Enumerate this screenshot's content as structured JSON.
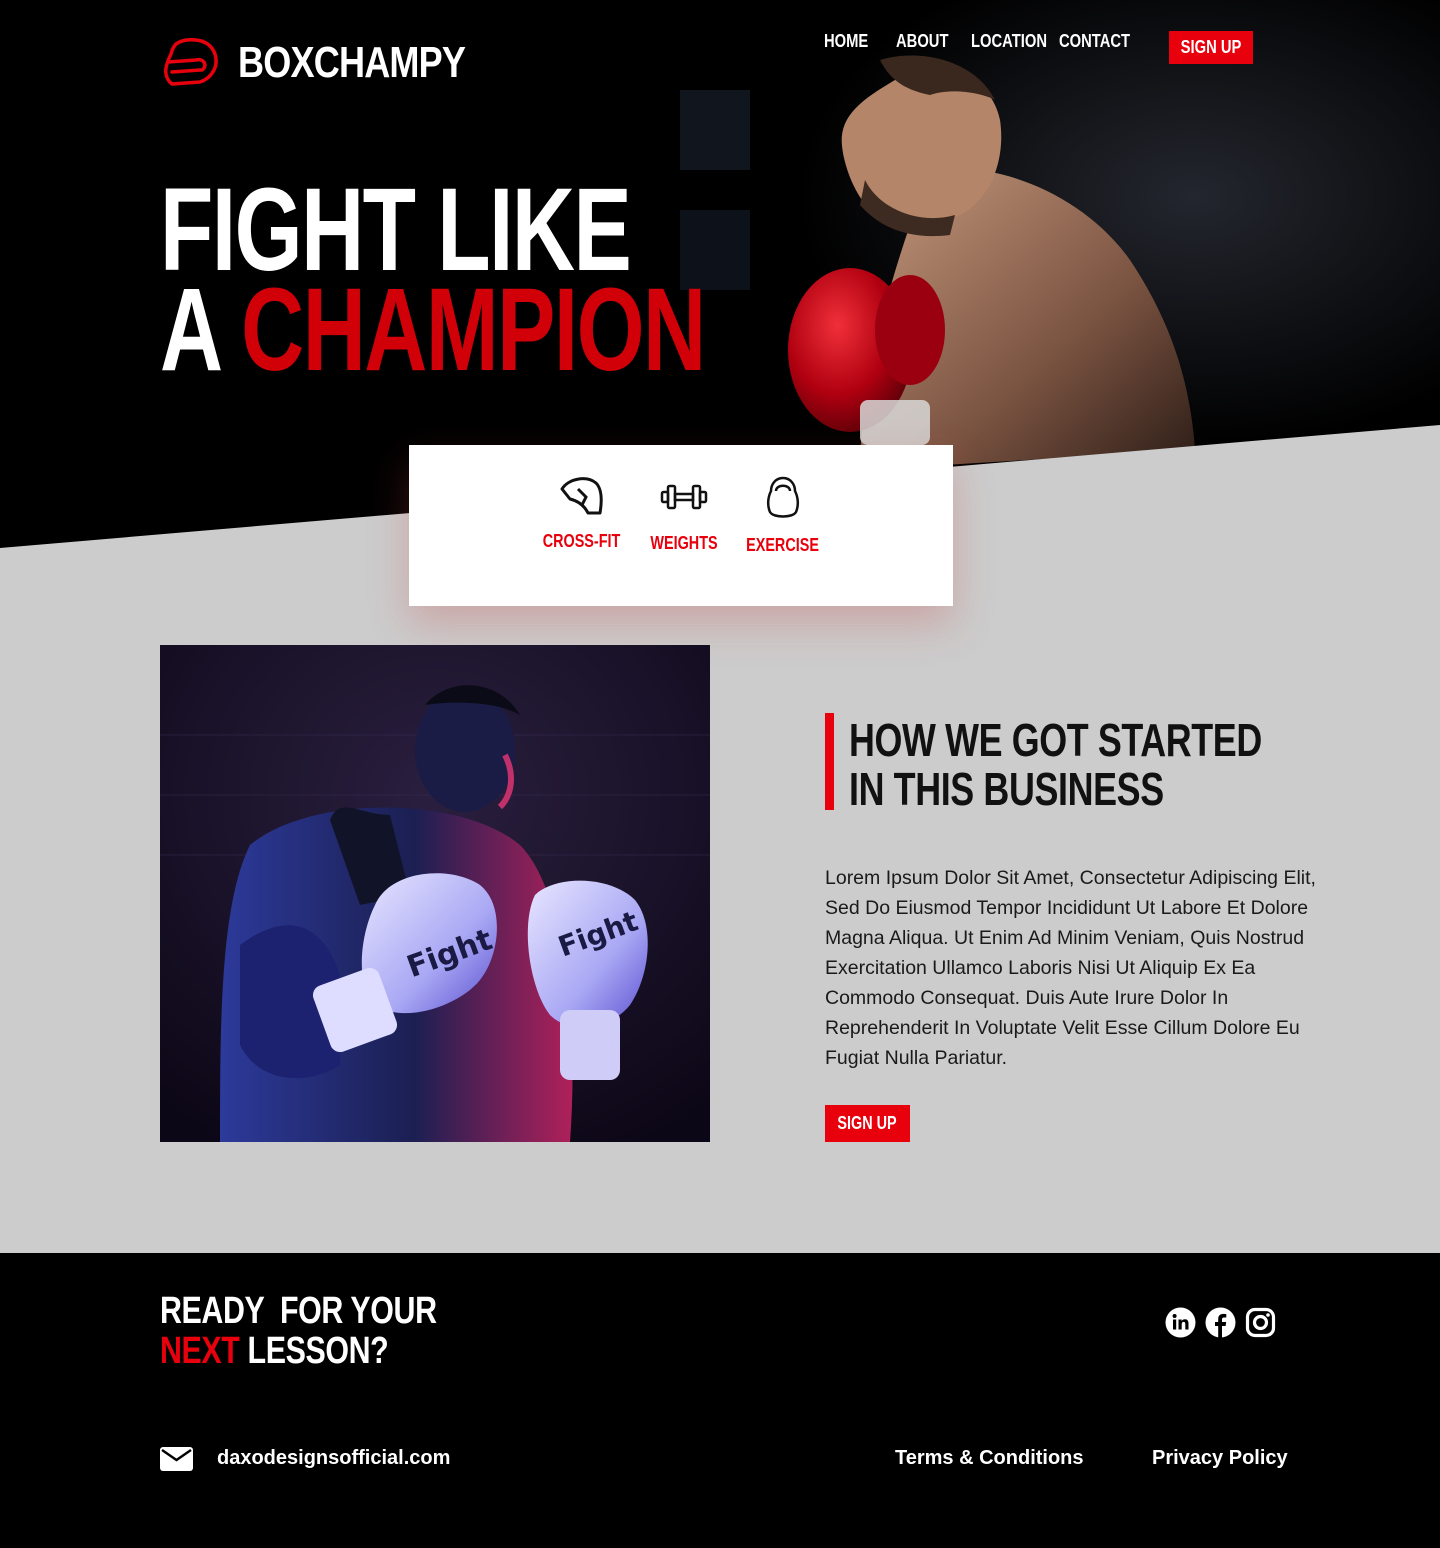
{
  "brand": {
    "name": "BOXCHAMPY",
    "accent": "#e8000c",
    "dark": "#000000",
    "light_bg": "#cccccc"
  },
  "nav": {
    "items": [
      {
        "label": "HOME"
      },
      {
        "label": "ABOUT"
      },
      {
        "label": "LOCATION"
      },
      {
        "label": "CONTACT"
      }
    ],
    "signup_label": "SIGN UP"
  },
  "hero": {
    "line1": "FIGHT LIKE",
    "line2_prefix": "A",
    "line2_highlight": "CHAMPION",
    "image": "boxer-with-red-gloves-photo"
  },
  "features": [
    {
      "label": "CROSS-FIT",
      "icon": "helmet-icon"
    },
    {
      "label": "WEIGHTS",
      "icon": "dumbbell-icon"
    },
    {
      "label": "EXERCISE",
      "icon": "kettlebell-icon"
    }
  ],
  "about": {
    "title_line1": "HOW WE GOT STARTED",
    "title_line2": "IN THIS BUSINESS",
    "body": "Lorem Ipsum Dolor Sit Amet, Consectetur Adipiscing Elit, Sed Do Eiusmod Tempor Incididunt Ut Labore Et Dolore Magna Aliqua. Ut Enim Ad Minim Veniam, Quis Nostrud Exercitation Ullamco Laboris Nisi Ut Aliquip Ex Ea Commodo Consequat. Duis Aute Irure Dolor In Reprehenderit In Voluptate Velit Esse Cillum Dolore Eu Fugiat Nulla Pariatur.",
    "button_label": "SIGN UP",
    "image": "boxer-in-neon-light-photo"
  },
  "footer": {
    "cta_line1": "READY  FOR YOUR",
    "cta_highlight": "NEXT",
    "cta_rest": " LESSON?",
    "social": [
      "linkedin-icon",
      "facebook-icon",
      "instagram-icon"
    ],
    "email": "daxodesignsofficial.com",
    "terms": "Terms & Conditions",
    "privacy": "Privacy Policy"
  }
}
